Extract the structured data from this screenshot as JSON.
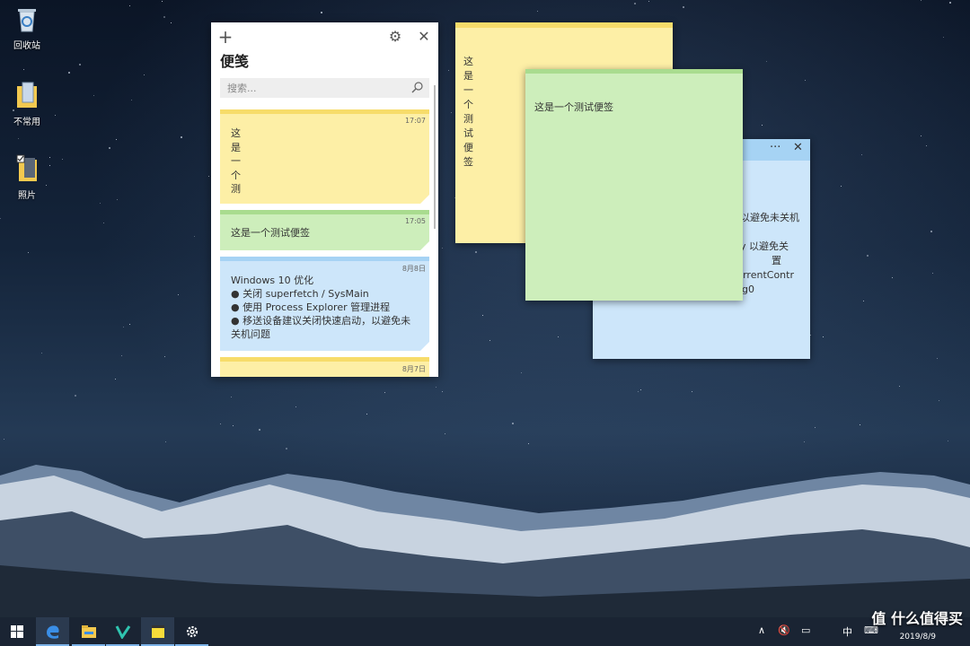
{
  "desktop_icons": [
    {
      "label": "回收站",
      "icon": "recycle-bin-icon"
    },
    {
      "label": "不常用",
      "icon": "folder-icon"
    },
    {
      "label": "照片",
      "icon": "folder-icon"
    }
  ],
  "notes_window": {
    "title": "便笺",
    "new_note_glyph": "+",
    "settings_glyph": "⚙",
    "close_glyph": "✕",
    "search_placeholder": "搜索...",
    "notes": [
      {
        "color": "yellow",
        "time": "17:07",
        "lines": [
          "这",
          "是",
          "一",
          "个",
          "测"
        ]
      },
      {
        "color": "green",
        "time": "17:05",
        "lines": [
          "这是一个测试便签"
        ]
      },
      {
        "color": "blue",
        "time": "8月8日",
        "lines": [
          "Windows 10 优化",
          "● 关闭 superfetch / SysMain",
          "● 使用 Process Explorer 管理进程",
          "● 移送设备建议关闭快速启动，以避免未",
          "关机问题"
        ]
      },
      {
        "color": "yellow",
        "time": "8月7日",
        "lines": [
          ""
        ]
      }
    ]
  },
  "floating_notes": {
    "yellow": {
      "text": "这是一个测试便签"
    },
    "green": {
      "text": "这是一个测试便签"
    },
    "blue": {
      "menu_glyph": "···",
      "close_glyph": "✕",
      "lines": [
        "以避免未关机",
        "by 以避免关",
        "置",
        "CurrentContr",
        "g0)"
      ]
    }
  },
  "taskbar": {
    "items": [
      "start-button",
      "edge-icon",
      "file-explorer-icon",
      "vim-icon",
      "sticky-notes-icon",
      "settings-icon"
    ],
    "tray": {
      "ime": "中",
      "date": "2019/8/9"
    }
  },
  "watermark": "值 什么值得买",
  "colors": {
    "yellow": "#fdefa6",
    "green": "#cdeebb",
    "blue": "#cde6fa",
    "taskbar": "#1a2433"
  }
}
